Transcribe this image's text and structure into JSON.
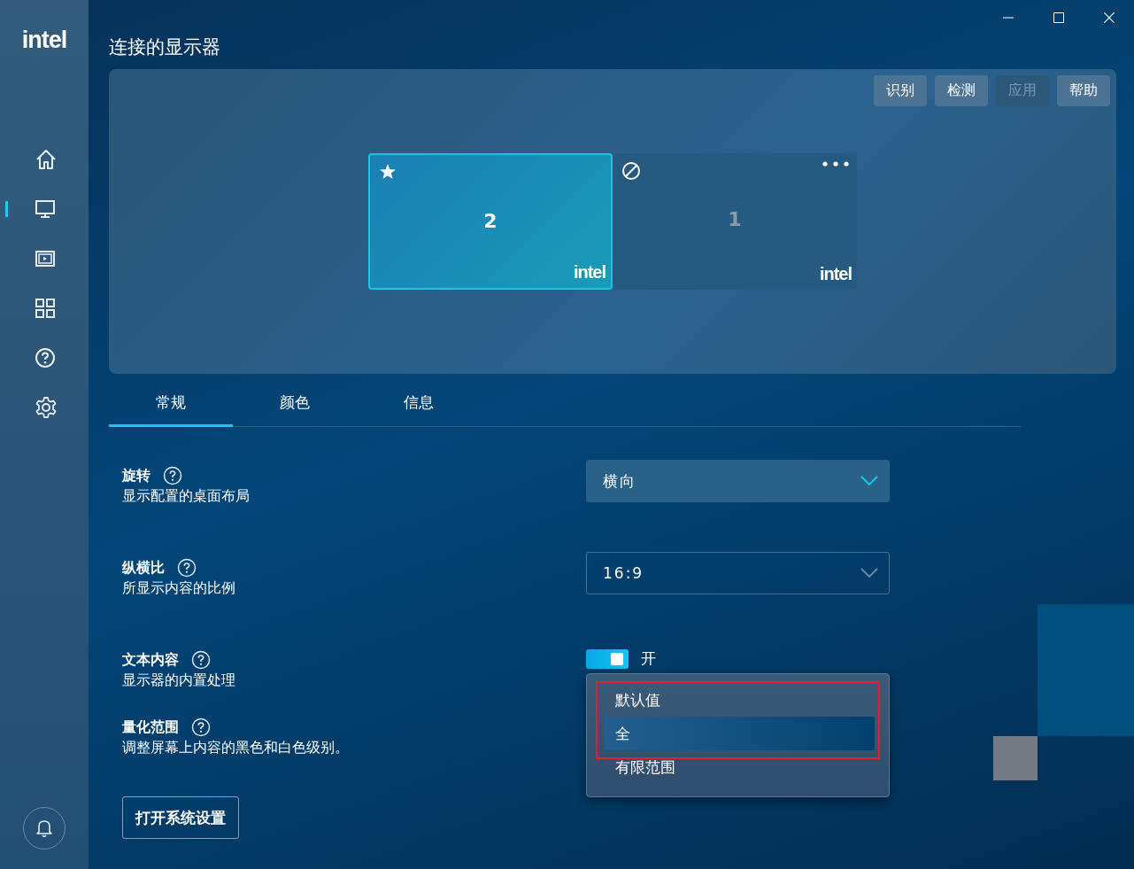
{
  "logo": "intel",
  "sidebar": {
    "items": [
      {
        "kind": "home",
        "selected": false
      },
      {
        "kind": "display",
        "selected": true
      },
      {
        "kind": "media",
        "selected": false
      },
      {
        "kind": "apps",
        "selected": false
      },
      {
        "kind": "help",
        "selected": false
      },
      {
        "kind": "settings",
        "selected": false
      }
    ]
  },
  "window": {
    "title": "连接的显示器"
  },
  "toolbar_buttons": [
    {
      "label": "识别",
      "disabled": false
    },
    {
      "label": "检测",
      "disabled": false
    },
    {
      "label": "应用",
      "disabled": true
    },
    {
      "label": "帮助",
      "disabled": false
    }
  ],
  "displays": [
    {
      "number": "2",
      "selected": true,
      "kind": "primary",
      "menu": false,
      "active": true,
      "logo": "intel"
    },
    {
      "number": "1",
      "selected": false,
      "kind": "disabled",
      "menu": true,
      "active": false,
      "logo": "intel"
    }
  ],
  "tabs": [
    {
      "label": "常规",
      "selected": true
    },
    {
      "label": "颜色",
      "selected": false
    },
    {
      "label": "信息",
      "selected": false
    }
  ],
  "settings": [
    {
      "title": "旋转",
      "description": "显示配置的桌面布局",
      "control": {
        "kind": "dropdown",
        "value": "横向",
        "highlighted": true
      }
    },
    {
      "title": "纵横比",
      "description": "所显示内容的比例",
      "control": {
        "kind": "dropdown",
        "value": "16:9",
        "highlighted": false
      }
    },
    {
      "title": "文本内容",
      "description": "显示器的内置处理",
      "control": {
        "kind": "toggle",
        "on": true,
        "label": "开"
      }
    },
    {
      "title": "量化范围",
      "description": "调整屏幕上内容的黑色和白色级别。",
      "control": {
        "kind": "open-dropdown",
        "options": [
          {
            "label": "默认值",
            "selected": false
          },
          {
            "label": "全",
            "selected": true
          },
          {
            "label": "有限范围",
            "selected": false
          }
        ]
      }
    }
  ],
  "open_settings_button": "打开系统设置"
}
